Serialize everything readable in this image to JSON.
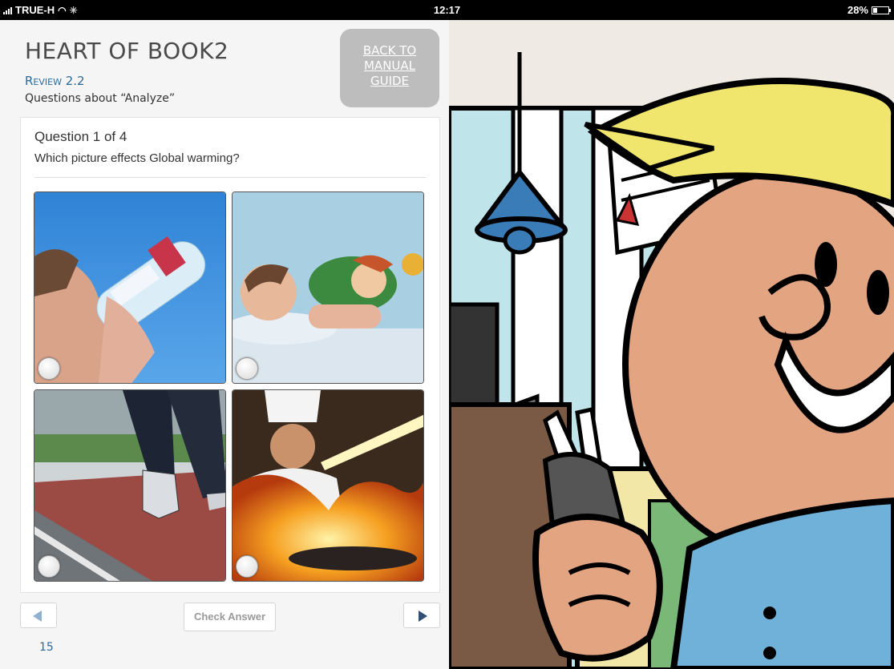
{
  "status_bar": {
    "carrier": "TRUE-H",
    "time": "12:17",
    "battery": "28%",
    "battery_level": 0.28,
    "icons": [
      "signal-icon",
      "wifi-icon",
      "activity-spinner-icon",
      "battery-icon"
    ]
  },
  "header": {
    "book_title": "HEART OF BOOK2",
    "section": "Review 2.2",
    "subtitle": "Questions about “Analyze”",
    "back_button": [
      "BACK TO",
      "MANUAL",
      "GUIDE"
    ]
  },
  "quiz": {
    "question_count": "Question 1 of 4",
    "question": "Which picture effects Global warming?",
    "options": [
      {
        "name": "drinking-water-photo",
        "selected": false
      },
      {
        "name": "sleeping-child-photo",
        "selected": false
      },
      {
        "name": "jogging-photo",
        "selected": false
      },
      {
        "name": "chef-cooking-fire-photo",
        "selected": false
      }
    ]
  },
  "footer": {
    "check_answer": "Check Answer",
    "prev_icon": "triangle-left-icon",
    "next_icon": "triangle-right-icon",
    "page_number": "15"
  },
  "colors": {
    "accent_blue": "#2b6a99",
    "back_button_bg": "#bdbdbd",
    "next_arrow": "#2f4f73",
    "prev_arrow": "#8fb0cf"
  }
}
